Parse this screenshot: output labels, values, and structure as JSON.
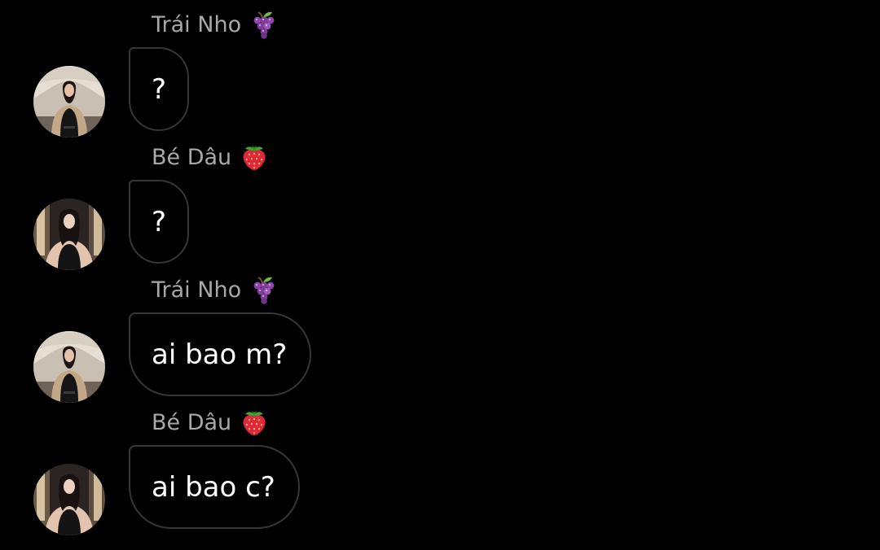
{
  "messages": [
    {
      "sender": "Trái Nho",
      "sender_emoji": "grapes-icon",
      "text": "?",
      "avatar": "avatar-trai-nho"
    },
    {
      "sender": "Bé Dâu",
      "sender_emoji": "strawberry-icon",
      "text": "?",
      "avatar": "avatar-be-dau"
    },
    {
      "sender": "Trái Nho",
      "sender_emoji": "grapes-icon",
      "text": "ai bao m?",
      "avatar": "avatar-trai-nho"
    },
    {
      "sender": "Bé Dâu",
      "sender_emoji": "strawberry-icon",
      "text": "ai bao c?",
      "avatar": "avatar-be-dau"
    }
  ],
  "colors": {
    "background": "#000000",
    "sender_name": "#a8a8a8",
    "bubble_border": "#363636",
    "message_text": "#ffffff",
    "grapes": "#7b3fa0",
    "strawberry": "#e0283c"
  }
}
